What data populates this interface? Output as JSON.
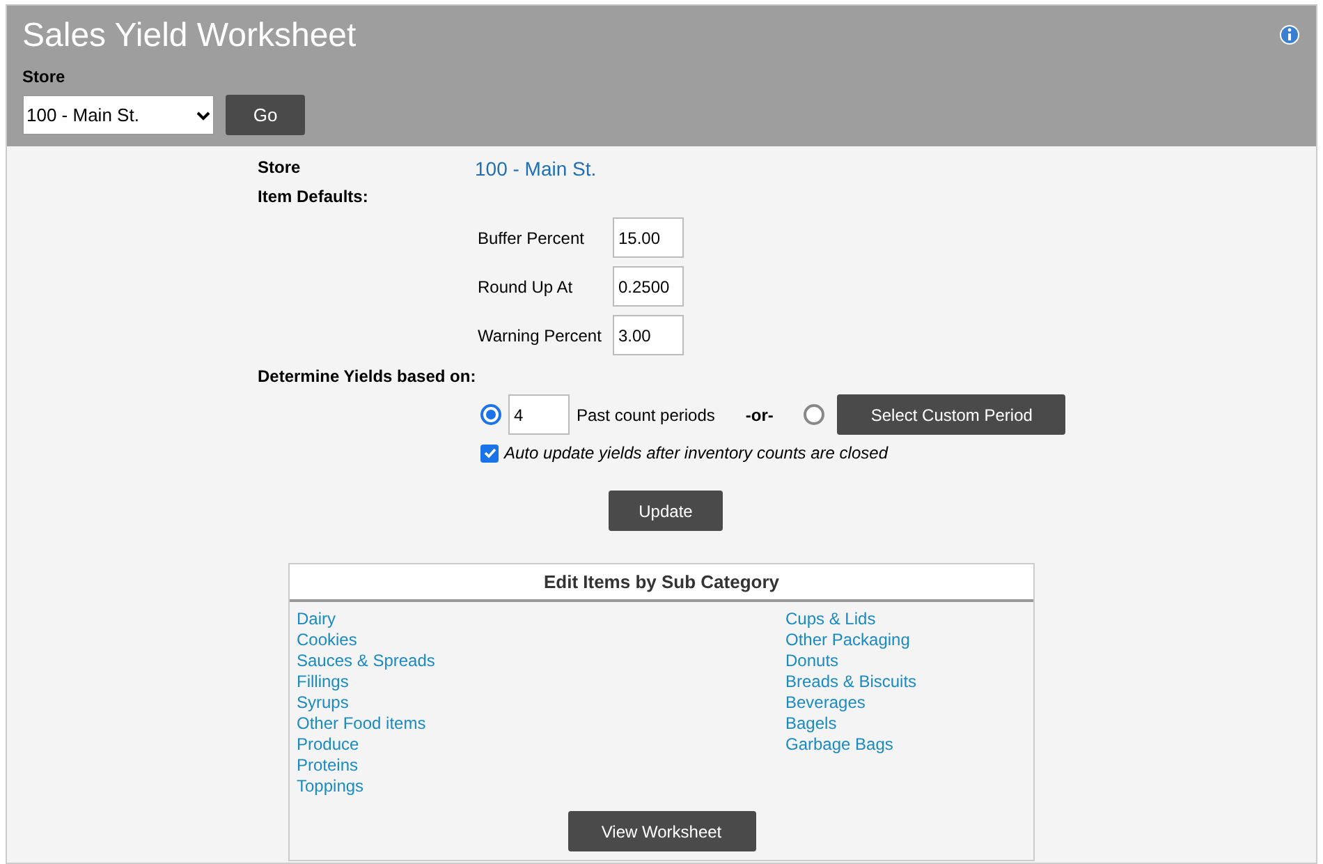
{
  "header": {
    "title": "Sales Yield Worksheet",
    "store_label": "Store",
    "store_select": "100 - Main St.",
    "go_button": "Go"
  },
  "summary": {
    "store_label": "Store",
    "store_value": "100 - Main St.",
    "item_defaults_label": "Item Defaults:"
  },
  "defaults": [
    {
      "label": "Buffer Percent",
      "value": "15.00"
    },
    {
      "label": "Round Up At",
      "value": "0.2500"
    },
    {
      "label": "Warning Percent",
      "value": "3.00"
    }
  ],
  "yields": {
    "label": "Determine Yields based on:",
    "options": [
      {
        "kind": "count",
        "selected": true,
        "value": "4",
        "label": "Past count periods"
      },
      {
        "kind": "custom",
        "selected": false,
        "button": "Select Custom Period"
      }
    ],
    "separator": "-or-",
    "auto_update": {
      "label": "Auto update yields after inventory counts are closed",
      "checked": true
    }
  },
  "update_button": "Update",
  "subcategories": {
    "title": "Edit Items by Sub Category",
    "columns": [
      [
        "Dairy",
        "Cookies",
        "Sauces & Spreads",
        "Fillings",
        "Syrups",
        "Other Food items",
        "Produce",
        "Proteins",
        "Toppings"
      ],
      [
        "Cups & Lids",
        "Other Packaging",
        "Donuts",
        "Breads & Biscuits",
        "Beverages",
        "Bagels",
        "Garbage Bags"
      ]
    ],
    "button": "View Worksheet"
  }
}
